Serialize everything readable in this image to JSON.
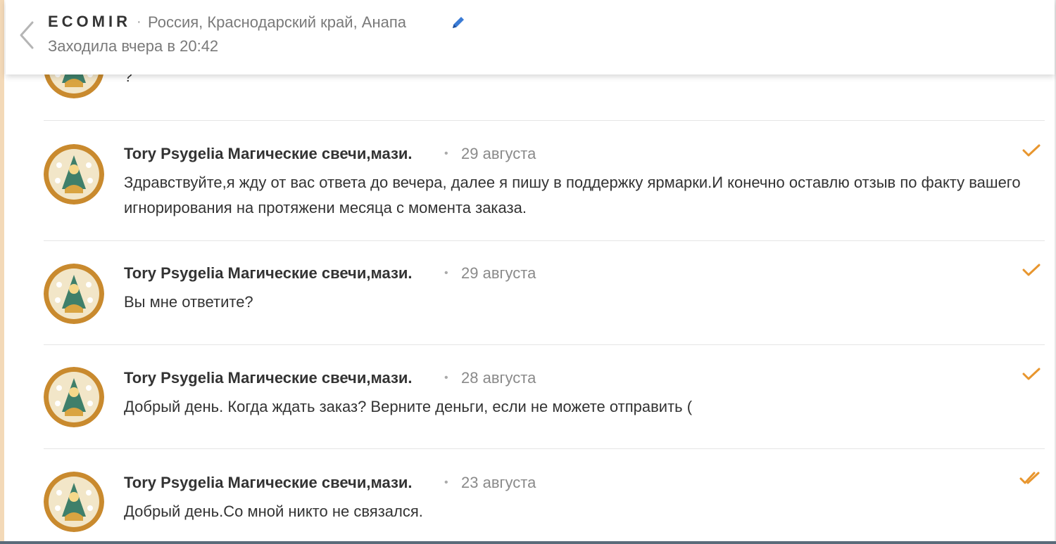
{
  "header": {
    "title": "ECOMIR",
    "separator": "·",
    "location": "Россия, Краснодарский край, Анапа",
    "status": "Заходила вчера в 20:42"
  },
  "partial_message": {
    "text": "?"
  },
  "messages": [
    {
      "author": "Tory Psygelia Магические свечи,мази.",
      "separator": "•",
      "date": "29 августа",
      "text": "Здравствуйте,я жду от вас ответа до вечера, далее я пишу в поддержку ярмарки.И конечно оставлю отзыв по факту вашего игнорирования на протяжени месяца с момента заказа.",
      "status_icon": "check-icon"
    },
    {
      "author": "Tory Psygelia Магические свечи,мази.",
      "separator": "•",
      "date": "29 августа",
      "text": "Вы мне ответите?",
      "status_icon": "check-icon"
    },
    {
      "author": "Tory Psygelia Магические свечи,мази.",
      "separator": "•",
      "date": "28 августа",
      "text": "Добрый день. Когда ждать заказ? Верните деньги, если не можете отправить (",
      "status_icon": "check-icon"
    },
    {
      "author": "Tory Psygelia Магические свечи,мази.",
      "separator": "•",
      "date": "23 августа",
      "text": "Добрый день.Со мной никто не связался.",
      "status_icon": "double-check-icon"
    }
  ],
  "colors": {
    "accent": "#e8962e",
    "edit_icon": "#3a7bd5",
    "avatar_bg": "#c98a2e"
  }
}
